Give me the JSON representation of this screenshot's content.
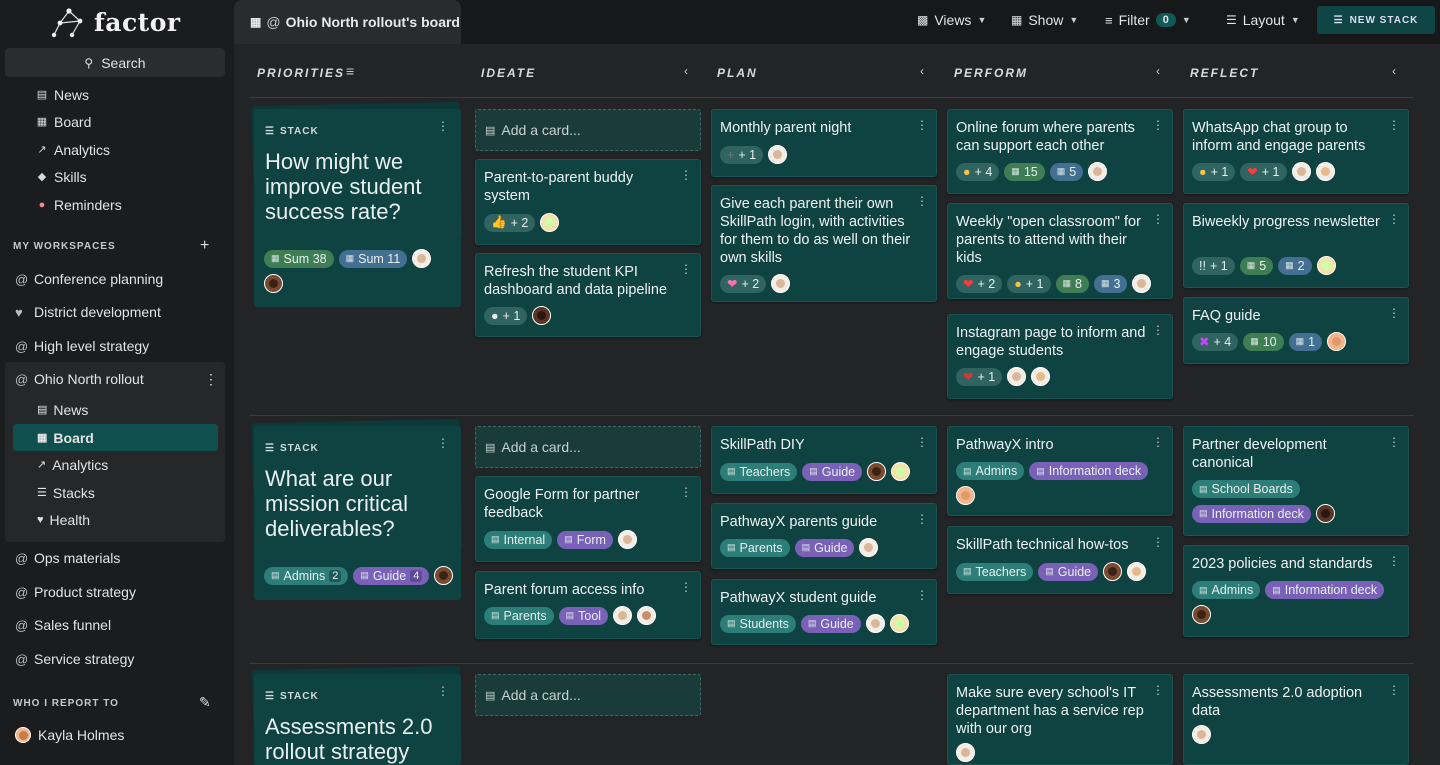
{
  "app": {
    "name": "factor",
    "search_label": "Search"
  },
  "sidebar": {
    "top_items": [
      {
        "label": "News",
        "icon": "news-icon"
      },
      {
        "label": "Board",
        "icon": "board-icon"
      },
      {
        "label": "Analytics",
        "icon": "analytics-icon"
      },
      {
        "label": "Skills",
        "icon": "skills-icon"
      },
      {
        "label": "Reminders",
        "icon": "bell-icon"
      }
    ],
    "workspaces_header": "MY WORKSPACES",
    "workspaces": [
      "Conference planning",
      "District development",
      "High level strategy",
      "Ohio North rollout",
      "Ops materials",
      "Product strategy",
      "Sales funnel",
      "Service strategy"
    ],
    "active_sub_items": [
      "News",
      "Board",
      "Analytics",
      "Stacks",
      "Health"
    ],
    "report_header": "WHO I REPORT TO",
    "report_person": "Kayla Holmes"
  },
  "topbar": {
    "tab_title": "Ohio North rollout's board",
    "views": "Views",
    "show": "Show",
    "filter": "Filter",
    "filter_count": "0",
    "layout": "Layout",
    "new_stack": "NEW STACK"
  },
  "columns": [
    "PRIORITIES",
    "IDEATE",
    "PLAN",
    "PERFORM",
    "REFLECT"
  ],
  "stack_label": "STACK",
  "add_card": "Add a card...",
  "stacks": [
    {
      "question": "How might we improve student success rate?",
      "chip1": "Sum 38",
      "chip2": "Sum 11"
    },
    {
      "question": "What are our mission critical deliverables?",
      "chip1": "Admins",
      "chip1_n": "2",
      "chip2": "Guide",
      "chip2_n": "4"
    },
    {
      "question": "Assessments 2.0 rollout strategy"
    }
  ],
  "cards": {
    "c1": {
      "title": "Parent-to-parent buddy system",
      "r1": "+ 2"
    },
    "c2": {
      "title": "Refresh the student KPI dashboard and data pipeline",
      "r1": "+ 1"
    },
    "c3": {
      "title": "Monthly parent night",
      "r1": "+ 1"
    },
    "c4": {
      "title": "Give each parent their own SkillPath login, with activities for them to do as well on their own skills",
      "r1": "+ 2"
    },
    "c5": {
      "title": "Online forum where parents can support each other",
      "r1": "+ 4",
      "g": "15",
      "b": "5"
    },
    "c6": {
      "title": "Weekly \"open classroom\" for parents to attend with their kids",
      "r1": "+ 2",
      "r2": "+ 1",
      "g": "8",
      "b": "3"
    },
    "c7": {
      "title": "Instagram page to inform and engage students",
      "r1": "+ 1"
    },
    "c8": {
      "title": "WhatsApp chat group to inform and engage parents",
      "r1": "+ 1",
      "r2": "+ 1"
    },
    "c9": {
      "title": "Biweekly progress newsletter",
      "r1": "+ 1",
      "g": "5",
      "b": "2",
      "r1_icon": "!!"
    },
    "c10": {
      "title": "FAQ guide",
      "r1": "+ 4",
      "g": "10",
      "b": "1"
    },
    "c11": {
      "title": "Google Form for partner feedback",
      "t1": "Internal",
      "t2": "Form"
    },
    "c12": {
      "title": "Parent forum access info",
      "t1": "Parents",
      "t2": "Tool"
    },
    "c13": {
      "title": "SkillPath DIY",
      "t1": "Teachers",
      "t2": "Guide"
    },
    "c14": {
      "title": "PathwayX parents guide",
      "t1": "Parents",
      "t2": "Guide"
    },
    "c15": {
      "title": "PathwayX student guide",
      "t1": "Students",
      "t2": "Guide"
    },
    "c16": {
      "title": "PathwayX intro",
      "t1": "Admins",
      "t2": "Information deck"
    },
    "c17": {
      "title": "SkillPath technical how-tos",
      "t1": "Teachers",
      "t2": "Guide"
    },
    "c18": {
      "title": "Partner development canonical",
      "t1": "School Boards",
      "t2": "Information deck"
    },
    "c19": {
      "title": "2023 policies and standards",
      "t1": "Admins",
      "t2": "Information deck"
    },
    "c20": {
      "title": "Make sure every school's IT department has a service rep with our org"
    },
    "c21": {
      "title": "Assessments 2.0 adoption data"
    }
  }
}
